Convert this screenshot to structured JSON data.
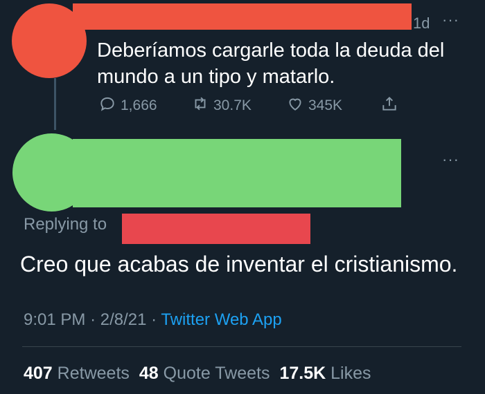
{
  "tweet1": {
    "time": "1d",
    "more": "···",
    "text": "Deberíamos cargarle toda la deuda del mundo a un tipo y matarlo.",
    "replies": "1,666",
    "retweets": "30.7K",
    "likes": "345K"
  },
  "tweet2": {
    "more": "···",
    "replying_label": "Replying to",
    "text": "Creo que acabas de inventar el cristianismo.",
    "time": "9:01 PM",
    "date": "2/8/21",
    "separator": "·",
    "source": "Twitter Web App",
    "retweets_count": "407",
    "retweets_label": "Retweets",
    "quote_count": "48",
    "quote_label": "Quote Tweets",
    "likes_count": "17.5K",
    "likes_label": "Likes"
  },
  "colors": {
    "background": "#15202b",
    "redaction_red": "#ef5440",
    "redaction_green": "#78d678",
    "link_blue": "#1da1f2",
    "muted": "#8899a6"
  },
  "icons": [
    "reply-icon",
    "retweet-icon",
    "like-icon",
    "share-icon",
    "more-icon"
  ]
}
